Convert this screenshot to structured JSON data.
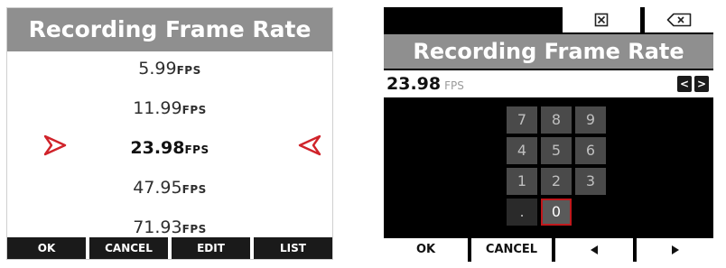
{
  "left_screen": {
    "title": "Recording Frame Rate",
    "rates": [
      {
        "value": "5.99",
        "unit": "FPS"
      },
      {
        "value": "11.99",
        "unit": "FPS"
      },
      {
        "value": "23.98",
        "unit": "FPS",
        "selected": true
      },
      {
        "value": "47.95",
        "unit": "FPS"
      },
      {
        "value": "71.93",
        "unit": "FPS"
      }
    ],
    "softkeys": [
      "OK",
      "CANCEL",
      "EDIT",
      "LIST"
    ],
    "arrow_color": "#d0232a"
  },
  "right_screen": {
    "title": "Recording Frame Rate",
    "entry_value": "23.98",
    "entry_unit": "FPS",
    "nav_left": "<",
    "nav_right": ">",
    "keypad": [
      "7",
      "8",
      "9",
      "4",
      "5",
      "6",
      "1",
      "2",
      "3",
      ".",
      "0"
    ],
    "focused_key": "0",
    "focus_color": "#c0181c",
    "top_icons": [
      "clear-icon",
      "backspace-icon"
    ],
    "bottom_keys": [
      "OK",
      "CANCEL"
    ],
    "bottom_icons": [
      "arrow-left-icon",
      "arrow-right-icon"
    ]
  }
}
